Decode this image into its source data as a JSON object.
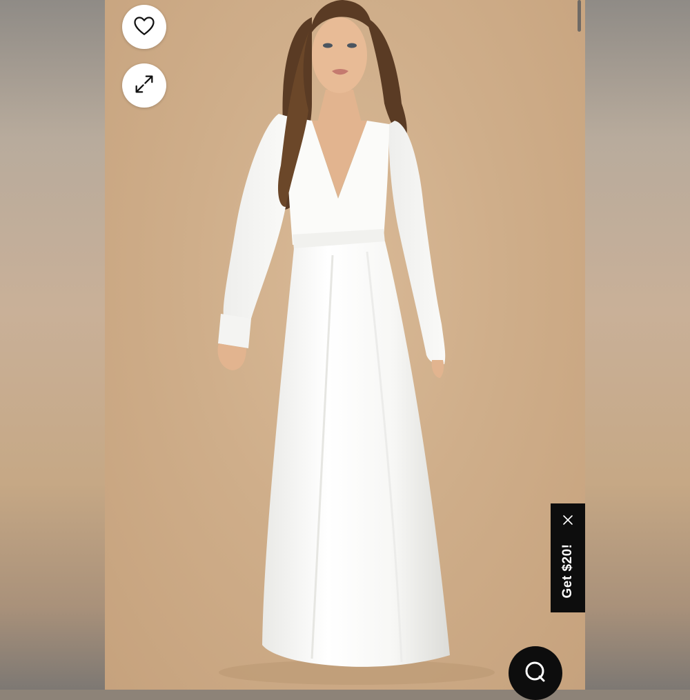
{
  "product_image": {
    "background_color": "#cfae8a",
    "dress_color": "#ffffff",
    "hair_color": "#5a3b24",
    "skin_color": "#e2b48f"
  },
  "actions": {
    "favorite_icon": "heart-outline-icon",
    "expand_icon": "expand-arrows-icon"
  },
  "promo": {
    "label": "Get $20!",
    "close_icon": "close-icon",
    "bg_color": "#0d0d0d"
  },
  "chat": {
    "icon": "chat-bubble-icon"
  }
}
